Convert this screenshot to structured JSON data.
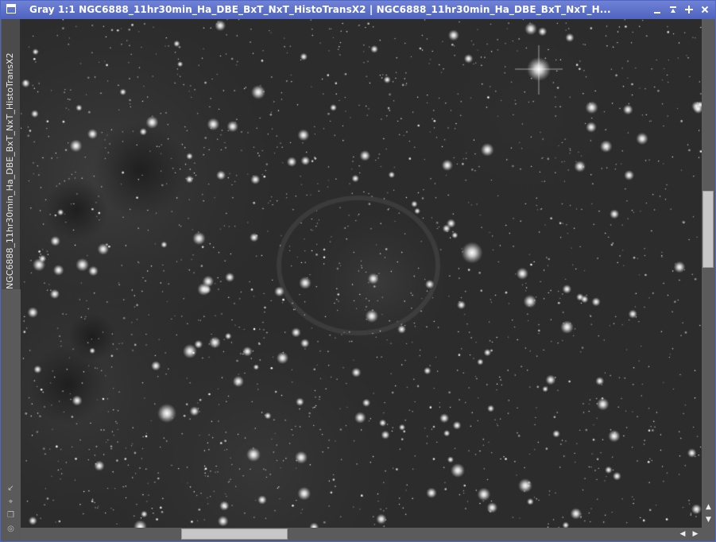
{
  "window": {
    "title": "Gray 1:1 NGC6888_11hr30min_Ha_DBE_BxT_NxT_HistoTransX2 | NGC6888_11hr30min_Ha_DBE_BxT_NxT_H...",
    "side_tab_label": "NGC6888_11hr30min_Ha_DBE_BxT_NxT_HistoTransX2",
    "accent_color": "#4f63bf"
  },
  "title_buttons": {
    "minimize": "minimize-icon",
    "shade": "shade-icon",
    "maximize": "maximize-icon",
    "close": "close-icon"
  },
  "left_tools": [
    {
      "icon": "resize-arrow-icon",
      "glyph": "↙"
    },
    {
      "icon": "fit-view-icon",
      "glyph": "⌖"
    },
    {
      "icon": "clone-icon",
      "glyph": "❐"
    },
    {
      "icon": "target-icon",
      "glyph": "◎"
    }
  ],
  "scrollbars": {
    "vertical_position": 0.38,
    "horizontal_position": 0.28,
    "up_glyph": "▲",
    "down_glyph": "▼",
    "left_glyph": "◀",
    "right_glyph": "▶"
  },
  "image": {
    "mode": "Gray",
    "zoom": "1:1",
    "subject": "NGC6888_11hr30min_Ha_DBE_BxT_NxT_HistoTransX2"
  }
}
